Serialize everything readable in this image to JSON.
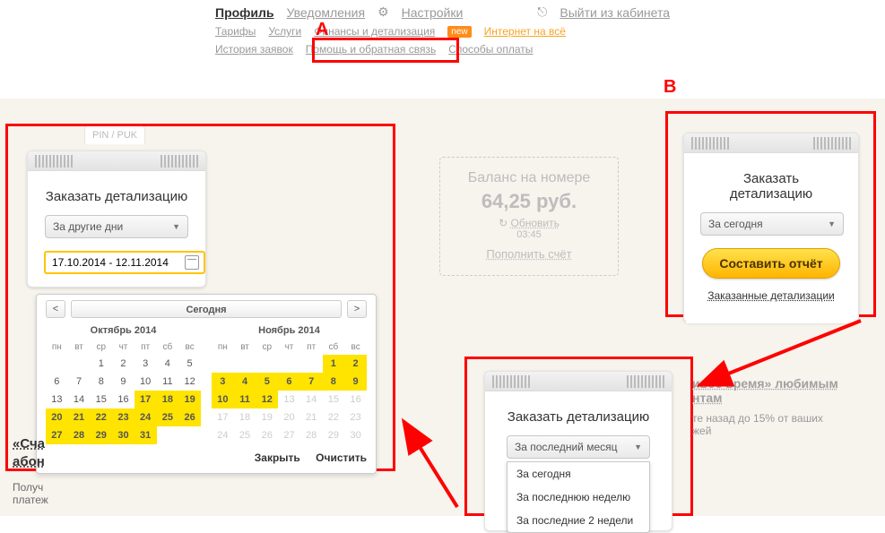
{
  "topnav": {
    "profile": "Профиль",
    "notifications": "Уведомления",
    "settings": "Настройки",
    "logout": "Выйти из кабинета",
    "row2": {
      "tariffs": "Тарифы",
      "services": "Услуги",
      "finance": "Финансы и детализация",
      "new": "new",
      "internet": "Интернет на всё"
    },
    "row3": {
      "history": "История заявок",
      "help": "Помощь и обратная связь",
      "payment": "Способы оплаты"
    }
  },
  "annotations": {
    "A": "A",
    "B": "B"
  },
  "tab_stub": "PIN / PUK",
  "widget_left": {
    "title": "Заказать детализацию",
    "select_value": "За другие дни",
    "date_input": "17.10.2014 - 12.11.2014"
  },
  "calendar": {
    "today": "Сегодня",
    "prev": "<",
    "next": ">",
    "month1": "Октябрь 2014",
    "month2": "Ноябрь 2014",
    "dow": [
      "пн",
      "вт",
      "ср",
      "чт",
      "пт",
      "сб",
      "вс"
    ],
    "close": "Закрыть",
    "clear": "Очистить"
  },
  "balance": {
    "label": "Баланс на номере",
    "amount": "64,25 руб.",
    "refresh": "Обновить",
    "time": "03:45",
    "topup": "Пополнить счёт"
  },
  "widget_right": {
    "title": "Заказать детализацию",
    "select_value": "За сегодня",
    "button": "Составить отчёт",
    "link": "Заказанные детализации"
  },
  "widget_mid": {
    "title": "Заказать детализацию",
    "select_value": "За последний месяц",
    "options": [
      "За сегодня",
      "За последнюю неделю",
      "За последние 2 недели"
    ]
  },
  "lefttext": {
    "h1": "«Сча",
    "h2": "абон",
    "p": "Получ\nплатеж"
  },
  "promo": {
    "h": "ивое время» любимым\nнтам",
    "p": "те назад  до 15% от ваших\nжей"
  }
}
